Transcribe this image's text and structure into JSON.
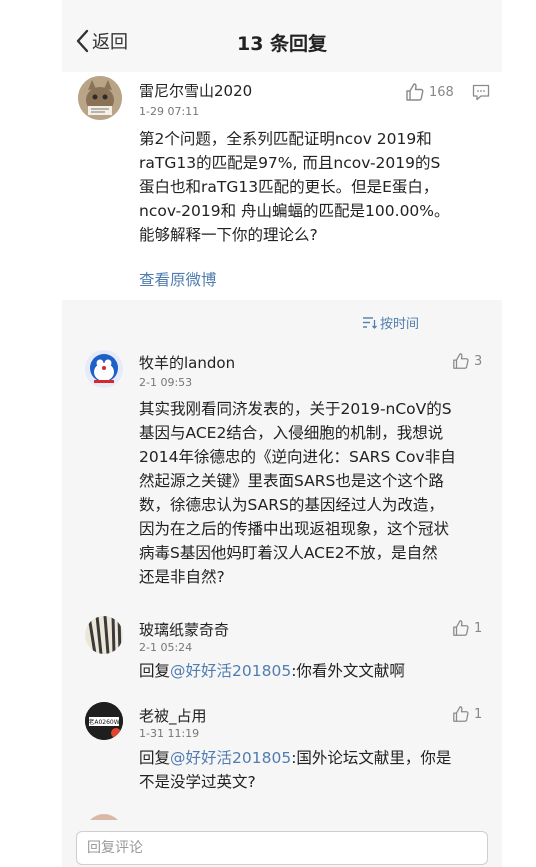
{
  "header": {
    "back_label": "返回",
    "title": "13 条回复"
  },
  "post": {
    "username": "雷尼尔雪山2020",
    "time": "1-29 07:11",
    "likes": "168",
    "lines": [
      "第2个问题，全系列匹配证明ncov 2019和",
      "raTG13的匹配是97%, 而且ncov-2019的S",
      "蛋白也和raTG13匹配的更长。但是E蛋白，",
      "ncov-2019和 舟山蝙蝠的匹配是100.00%。",
      "能够解释一下你的理论么?"
    ],
    "view_original": "查看原微博"
  },
  "sort_label": "按时间",
  "replies": [
    {
      "username": "牧羊的landon",
      "time": "2-1 09:53",
      "likes": "3",
      "lines": [
        "其实我刚看同济发表的，关于2019-nCoV的S",
        "基因与ACE2结合，入侵细胞的机制，我想说",
        "2014年徐德忠的《逆向进化：SARS Cov非自",
        "然起源之关键》里表面SARS也是这个这个路",
        "数，徐德忠认为SARS的基因经过人为改造，",
        "因为在之后的传播中出现返祖现象，这个冠状",
        "病毒S基因他妈盯着汉人ACE2不放，是自然",
        "还是非自然?"
      ]
    },
    {
      "username": "玻璃纸蒙奇奇",
      "time": "2-1 05:24",
      "likes": "1",
      "reply_prefix": "回复",
      "mention": "@好好活201805",
      "line1_rest": ":你看外文文献啊"
    },
    {
      "username": "老被_占用",
      "avatar_text": "老A0260W",
      "time": "1-31 11:19",
      "likes": "1",
      "reply_prefix": "回复",
      "mention": "@好好活201805",
      "line1_rest": ":国外论坛文献里，你是",
      "line2": "不是没学过英文?"
    }
  ],
  "input": {
    "placeholder": "回复评论"
  }
}
